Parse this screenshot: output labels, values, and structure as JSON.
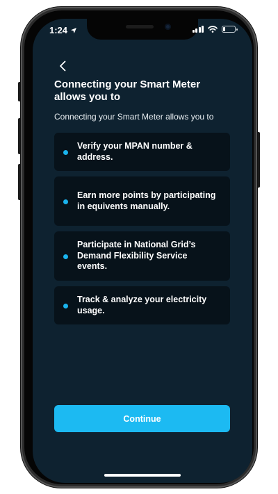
{
  "status_bar": {
    "time": "1:24",
    "location_icon": "location-arrow-icon",
    "signal_icon": "cellular-signal-icon",
    "wifi_icon": "wifi-icon",
    "battery_icon": "battery-icon",
    "battery_level": 0.2
  },
  "header": {
    "back_icon": "chevron-left-icon",
    "title": "Connecting your Smart Meter allows you to",
    "subtitle": "Connecting your Smart Meter allows you to"
  },
  "benefits": [
    {
      "text": "Verify your MPAN number & address."
    },
    {
      "text": "Earn more points by participating in equivents manually."
    },
    {
      "text": "Participate in National Grid’s Demand Flexibility Service events."
    },
    {
      "text": "Track & analyze your electricity usage."
    }
  ],
  "actions": {
    "continue_label": "Continue"
  },
  "colors": {
    "screen_background": "#0e2230",
    "card_background": "#07121a",
    "accent": "#1cbaf2",
    "bullet": "#1ab4ee"
  }
}
